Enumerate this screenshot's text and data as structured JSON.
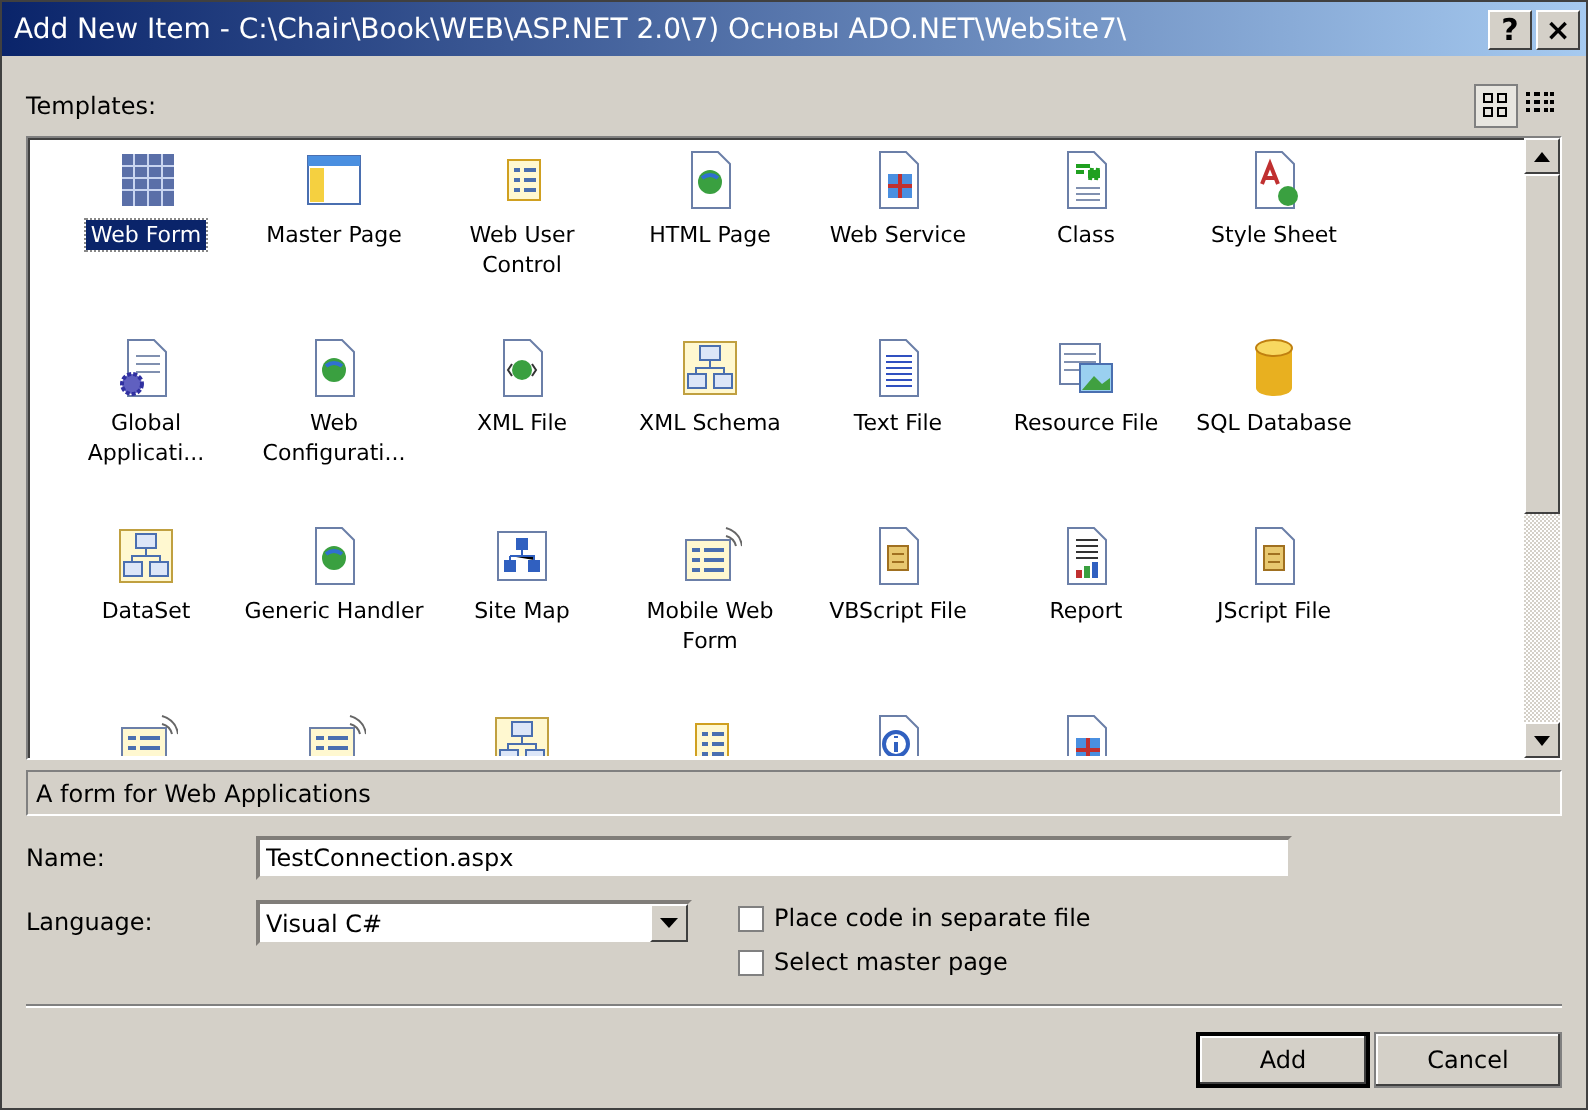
{
  "window": {
    "title": "Add New Item - C:\\Chair\\Book\\WEB\\ASP.NET 2.0\\7) Основы ADO.NET\\WebSite7\\",
    "buttons": [
      "?",
      "×"
    ]
  },
  "templates_label": "Templates:",
  "view_buttons": [
    {
      "kind": "large",
      "selected": true
    },
    {
      "kind": "small",
      "selected": false
    }
  ],
  "templates": [
    {
      "label": "Web Form",
      "kind": "grid",
      "selected": true
    },
    {
      "label": "Master Page",
      "kind": "window",
      "selected": false
    },
    {
      "label": "Web User Control",
      "kind": "list",
      "selected": false
    },
    {
      "label": "HTML Page",
      "kind": "globe",
      "selected": false
    },
    {
      "label": "Web Service",
      "kind": "service",
      "selected": false
    },
    {
      "label": "Class",
      "kind": "csharp",
      "selected": false
    },
    {
      "label": "Style Sheet",
      "kind": "style",
      "selected": false
    },
    {
      "label": "Global Applicati...",
      "kind": "gear",
      "selected": false
    },
    {
      "label": "Web Configurati...",
      "kind": "globe",
      "selected": false
    },
    {
      "label": "XML File",
      "kind": "code",
      "selected": false
    },
    {
      "label": "XML Schema",
      "kind": "diagram",
      "selected": false
    },
    {
      "label": "Text File",
      "kind": "text",
      "selected": false
    },
    {
      "label": "Resource File",
      "kind": "image",
      "selected": false
    },
    {
      "label": "SQL Database",
      "kind": "database",
      "selected": false
    },
    {
      "label": "DataSet",
      "kind": "diagram",
      "selected": false
    },
    {
      "label": "Generic Handler",
      "kind": "globe",
      "selected": false
    },
    {
      "label": "Site Map",
      "kind": "sitemap",
      "selected": false
    },
    {
      "label": "Mobile Web Form",
      "kind": "mobile",
      "selected": false
    },
    {
      "label": "VBScript File",
      "kind": "scroll",
      "selected": false
    },
    {
      "label": "Report",
      "kind": "chart",
      "selected": false
    },
    {
      "label": "JScript File",
      "kind": "scroll",
      "selected": false
    },
    {
      "kind": "mobile"
    },
    {
      "kind": "mobile"
    },
    {
      "kind": "diagram"
    },
    {
      "kind": "list"
    },
    {
      "kind": "info"
    },
    {
      "kind": "service"
    }
  ],
  "description": "A form for Web Applications",
  "name_field": {
    "label": "Name:",
    "value": "TestConnection.aspx"
  },
  "language_field": {
    "label": "Language:",
    "value": "Visual C#"
  },
  "options": [
    {
      "label": "Place code in separate file",
      "checked": false
    },
    {
      "label": "Select master page",
      "checked": false
    }
  ],
  "actions": [
    {
      "label": "Add",
      "default": true
    },
    {
      "label": "Cancel",
      "default": false
    }
  ]
}
